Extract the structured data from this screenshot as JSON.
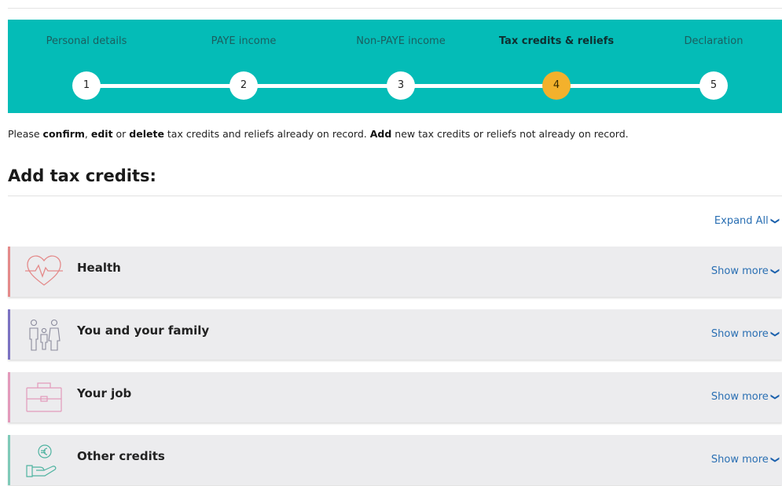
{
  "stepper": {
    "steps": [
      {
        "label": "Personal details",
        "number": "1"
      },
      {
        "label": "PAYE income",
        "number": "2"
      },
      {
        "label": "Non-PAYE income",
        "number": "3"
      },
      {
        "label": "Tax credits & reliefs",
        "number": "4"
      },
      {
        "label": "Declaration",
        "number": "5"
      }
    ],
    "active_step": 4,
    "colors": {
      "band": "#04bcb7",
      "active": "#f3b12c"
    }
  },
  "intro": {
    "t1": "Please ",
    "confirm": "confirm",
    "t2": ", ",
    "edit": "edit",
    "t3": " or ",
    "delete": "delete",
    "t4": " tax credits and reliefs already on record. ",
    "add": "Add",
    "t5": " new tax credits or reliefs not already on record."
  },
  "section": {
    "title": "Add tax credits:"
  },
  "expand_all": {
    "label": "Expand All",
    "icon": "chevron-down-icon"
  },
  "categories": [
    {
      "label": "Health",
      "show_more": "Show more",
      "icon": "heart-pulse-icon",
      "accent": "#e48a8a"
    },
    {
      "label": "You and your family",
      "show_more": "Show more",
      "icon": "family-icon",
      "accent": "#7b72c2"
    },
    {
      "label": "Your job",
      "show_more": "Show more",
      "icon": "briefcase-icon",
      "accent": "#e39abb"
    },
    {
      "label": "Other credits",
      "show_more": "Show more",
      "icon": "hand-coin-icon",
      "accent": "#7fcab8"
    }
  ]
}
